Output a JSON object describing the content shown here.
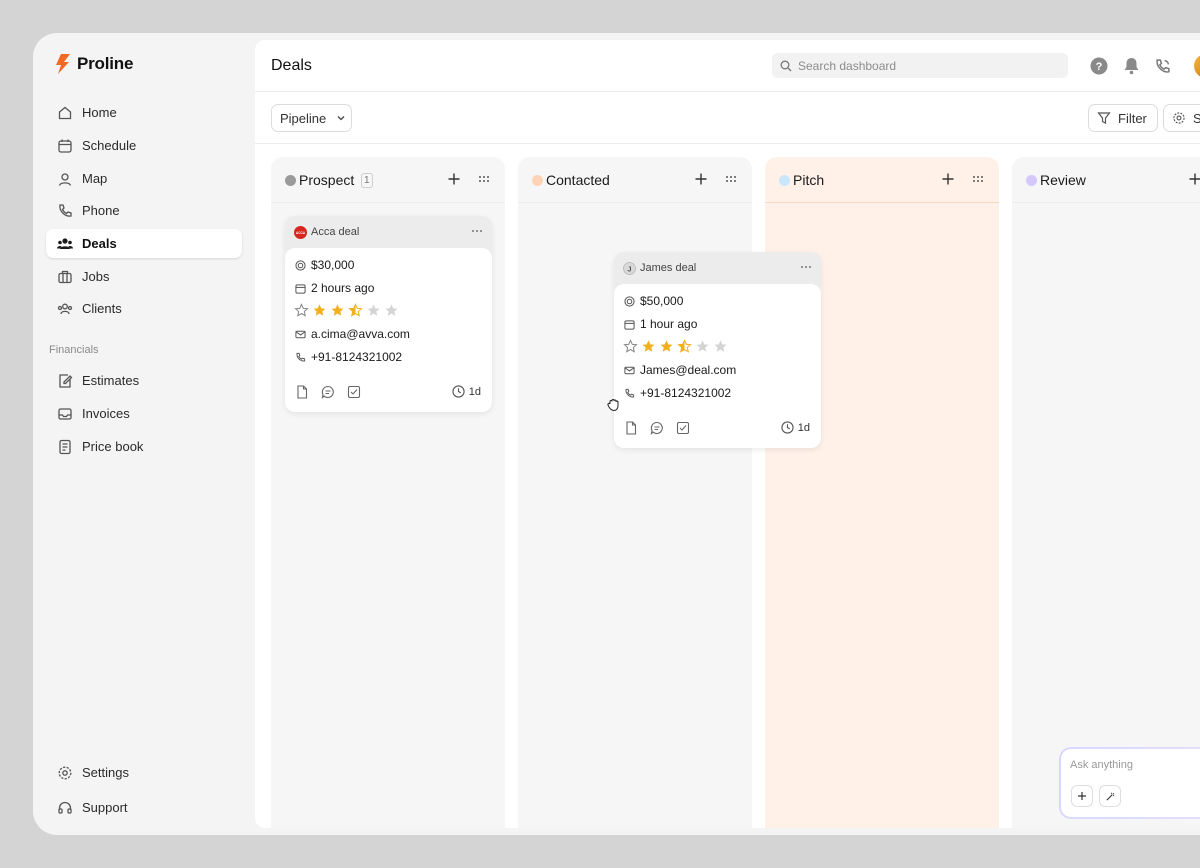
{
  "app": {
    "name": "Proline",
    "brand_color": "#f06a26"
  },
  "sidebar": {
    "items": [
      {
        "label": "Home",
        "icon": "home-icon"
      },
      {
        "label": "Schedule",
        "icon": "calendar-icon"
      },
      {
        "label": "Map",
        "icon": "map-pin-icon"
      },
      {
        "label": "Phone",
        "icon": "phone-icon"
      },
      {
        "label": "Deals",
        "icon": "users-icon",
        "active": true
      },
      {
        "label": "Jobs",
        "icon": "briefcase-icon"
      },
      {
        "label": "Clients",
        "icon": "clients-icon"
      }
    ],
    "section_label": "Financials",
    "financial_items": [
      {
        "label": "Estimates",
        "icon": "edit-doc-icon"
      },
      {
        "label": "Invoices",
        "icon": "inbox-icon"
      },
      {
        "label": "Price book",
        "icon": "receipt-icon"
      }
    ],
    "bottom_items": [
      {
        "label": "Settings",
        "icon": "gear-icon"
      },
      {
        "label": "Support",
        "icon": "headset-icon"
      }
    ]
  },
  "header": {
    "title": "Deals",
    "search_placeholder": "Search dashboard"
  },
  "toolbar": {
    "view_select": "Pipeline",
    "filter_label": "Filter",
    "settings_label": "S"
  },
  "columns": [
    {
      "title": "Prospect",
      "color": "#9a9a9a",
      "count": "1"
    },
    {
      "title": "Contacted",
      "color": "#fcd3b5"
    },
    {
      "title": "Pitch",
      "color": "#c9e6fb"
    },
    {
      "title": "Review",
      "color": "#d4c8fa"
    }
  ],
  "deals": [
    {
      "name": "Acca deal",
      "logo_text": "ACCA",
      "amount": "$30,000",
      "time": "2 hours ago",
      "rating": 2.5,
      "rating_max": 5,
      "email": "a.cima@avva.com",
      "phone": "+91-8124321002",
      "age": "1d"
    },
    {
      "name": "James deal",
      "logo_text": "J",
      "amount": "$50,000",
      "time": "1 hour ago",
      "rating": 2.5,
      "rating_max": 5,
      "email": "James@deal.com",
      "phone": "+91-8124321002",
      "age": "1d"
    }
  ],
  "assistant": {
    "placeholder": "Ask anything"
  }
}
